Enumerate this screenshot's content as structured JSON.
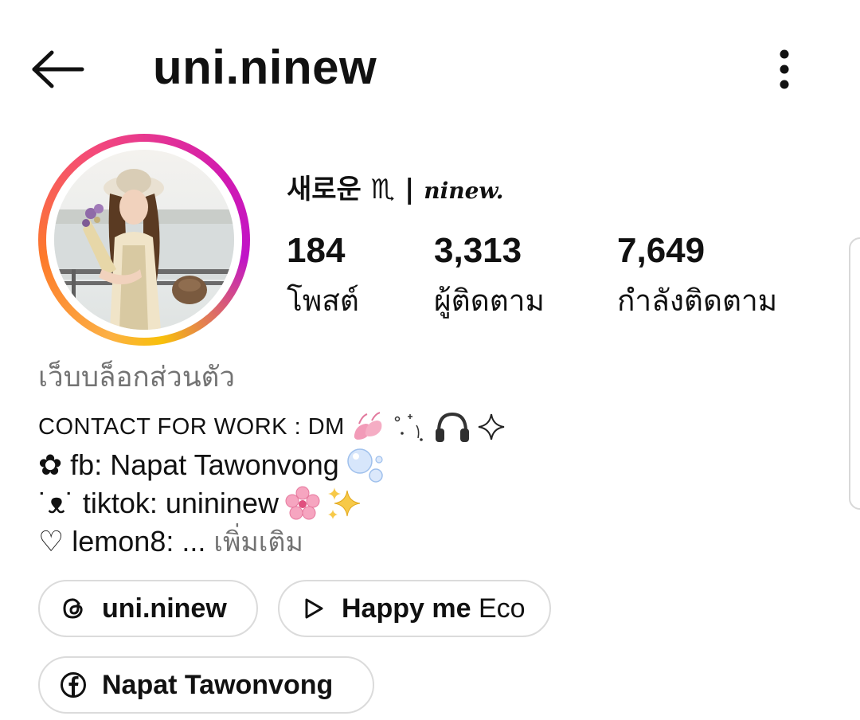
{
  "header": {
    "username": "uni.ninew",
    "back_icon": "arrow-left-icon",
    "more_icon": "more-vertical-icon"
  },
  "profile": {
    "display_name_prefix": "새로운 ♏︎ | ",
    "display_name_script": "ninew.",
    "avatar_description_icon": "profile-photo",
    "ring_colors": [
      "#fcb045",
      "#f44a7a",
      "#c013c8"
    ]
  },
  "stats": [
    {
      "value": "184",
      "label": "โพสต์"
    },
    {
      "value": "3,313",
      "label": "ผู้ติดตาม"
    },
    {
      "value": "7,649",
      "label": "กำลังติดตาม"
    }
  ],
  "category": "เว็บบล็อกส่วนตัว",
  "bio": {
    "line1": "CONTACT FOR WORK : DM",
    "line2": "✿ fb: Napat Tawonvong",
    "line3": "˙ᴥ˙ tiktok: unininew",
    "line4": "♡ lemon8: ...",
    "more_label": "เพิ่มเติม"
  },
  "links": {
    "threads": {
      "label": "uni.ninew",
      "icon": "threads-icon"
    },
    "music": {
      "label_bold": "Happy me",
      "label_regular": " Eco",
      "icon": "play-icon"
    },
    "facebook": {
      "label": "Napat Tawonvong",
      "icon": "facebook-icon"
    }
  },
  "colors": {
    "secondary_text": "#737373",
    "pill_border": "#dbdbdb"
  }
}
